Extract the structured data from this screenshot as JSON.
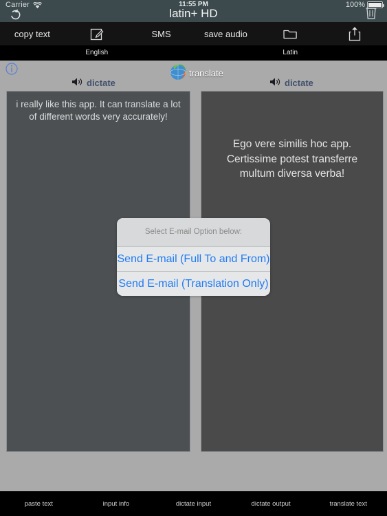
{
  "status": {
    "carrier": "Carrier",
    "wifi_icon": "wifi-icon",
    "time": "11:55 PM",
    "battery_percent": "100%",
    "battery_icon": "battery-icon"
  },
  "navbar": {
    "title": "latin+ HD",
    "refresh_icon": "refresh-icon",
    "trash_icon": "trash-icon",
    "background": "#3d4a4d"
  },
  "toolbar": {
    "items": [
      {
        "label": "copy text",
        "icon": "",
        "name": "copy-text-button"
      },
      {
        "label": "",
        "icon": "compose-icon",
        "name": "compose-button"
      },
      {
        "label": "SMS",
        "icon": "",
        "name": "sms-button"
      },
      {
        "label": "save audio",
        "icon": "",
        "name": "save-audio-button"
      },
      {
        "label": "",
        "icon": "folder-icon",
        "name": "folder-button"
      },
      {
        "label": "",
        "icon": "share-icon",
        "name": "share-button"
      }
    ]
  },
  "languages": {
    "source": "English",
    "target": "Latin"
  },
  "actions": {
    "info_icon": "info-icon",
    "dictate_left": "dictate",
    "dictate_right": "dictate",
    "translate_label": "translate",
    "translate_icon": "globe-icon",
    "accent_blue": "#40506b"
  },
  "panels": {
    "source_text": "i really like this app. It can translate a lot of different words very accurately!",
    "target_text": "Ego vere similis hoc app. Certissime potest transferre multum diversa verba!"
  },
  "action_sheet": {
    "title": "Select E-mail Option below:",
    "options": [
      "Send E-mail (Full To and From)",
      "Send E-mail (Translation Only)"
    ],
    "link_color": "#1f7bf5"
  },
  "bottom_bar": {
    "items": [
      "paste text",
      "input info",
      "dictate input",
      "dictate output",
      "translate text"
    ]
  }
}
